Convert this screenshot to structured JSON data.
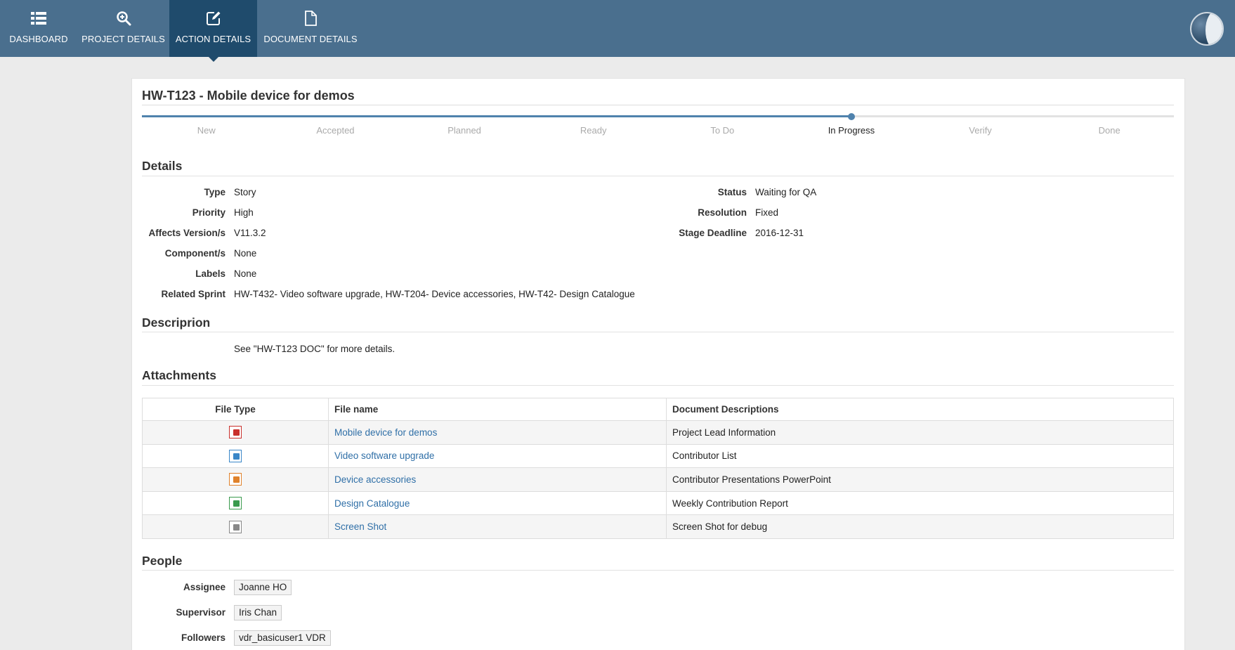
{
  "nav": {
    "items": [
      {
        "label": "DASHBOARD",
        "icon": "list-icon"
      },
      {
        "label": "PROJECT DETAILS",
        "icon": "zoom-in-icon"
      },
      {
        "label": "ACTION DETAILS",
        "icon": "edit-icon"
      },
      {
        "label": "DOCUMENT DETAILS",
        "icon": "document-icon"
      }
    ],
    "active": "ACTION DETAILS"
  },
  "title": "HW-T123 - Mobile device for demos",
  "workflow": {
    "stages": [
      "New",
      "Accepted",
      "Planned",
      "Ready",
      "To Do",
      "In Progress",
      "Verify",
      "Done"
    ],
    "current": "In Progress"
  },
  "details": {
    "heading": "Details",
    "left": [
      {
        "label": "Type",
        "value": "Story"
      },
      {
        "label": "Priority",
        "value": "High"
      },
      {
        "label": "Affects Version/s",
        "value": "V11.3.2"
      },
      {
        "label": "Component/s",
        "value": "None"
      },
      {
        "label": "Labels",
        "value": "None"
      },
      {
        "label": "Related Sprint",
        "value": "HW-T432- Video software upgrade, HW-T204- Device accessories, HW-T42- Design Catalogue"
      }
    ],
    "right": [
      {
        "label": "Status",
        "value": "Waiting for QA"
      },
      {
        "label": "Resolution",
        "value": "Fixed"
      },
      {
        "label": "Stage Deadline",
        "value": "2016-12-31"
      }
    ]
  },
  "description": {
    "heading": "Descriprion",
    "text": "See \"HW-T123 DOC\" for more details."
  },
  "attachments": {
    "heading": "Attachments",
    "columns": [
      "File Type",
      "File name",
      "Document Descriptions"
    ],
    "rows": [
      {
        "file_type": "pdf",
        "color": "#c9302c",
        "file_name": "Mobile device for demos",
        "description": "Project Lead Information"
      },
      {
        "file_type": "word",
        "color": "#3a87c8",
        "file_name": "Video software upgrade",
        "description": "Contributor List"
      },
      {
        "file_type": "powerpoint",
        "color": "#e0822b",
        "file_name": "Device accessories",
        "description": "Contributor Presentations PowerPoint"
      },
      {
        "file_type": "excel",
        "color": "#3a9a4d",
        "file_name": "Design Catalogue",
        "description": "Weekly Contribution Report"
      },
      {
        "file_type": "image",
        "color": "#888888",
        "file_name": "Screen Shot",
        "description": "Screen Shot for debug"
      }
    ]
  },
  "people": {
    "heading": "People",
    "rows": [
      {
        "label": "Assignee",
        "value": "Joanne HO"
      },
      {
        "label": "Supervisor",
        "value": "Iris Chan"
      },
      {
        "label": "Followers",
        "value": "vdr_basicuser1 VDR"
      }
    ]
  },
  "colors": {
    "topbar": "#4a6f8e",
    "active_tab": "#1f4b6c",
    "progress": "#4f82ad",
    "link": "#2f6fa7"
  }
}
